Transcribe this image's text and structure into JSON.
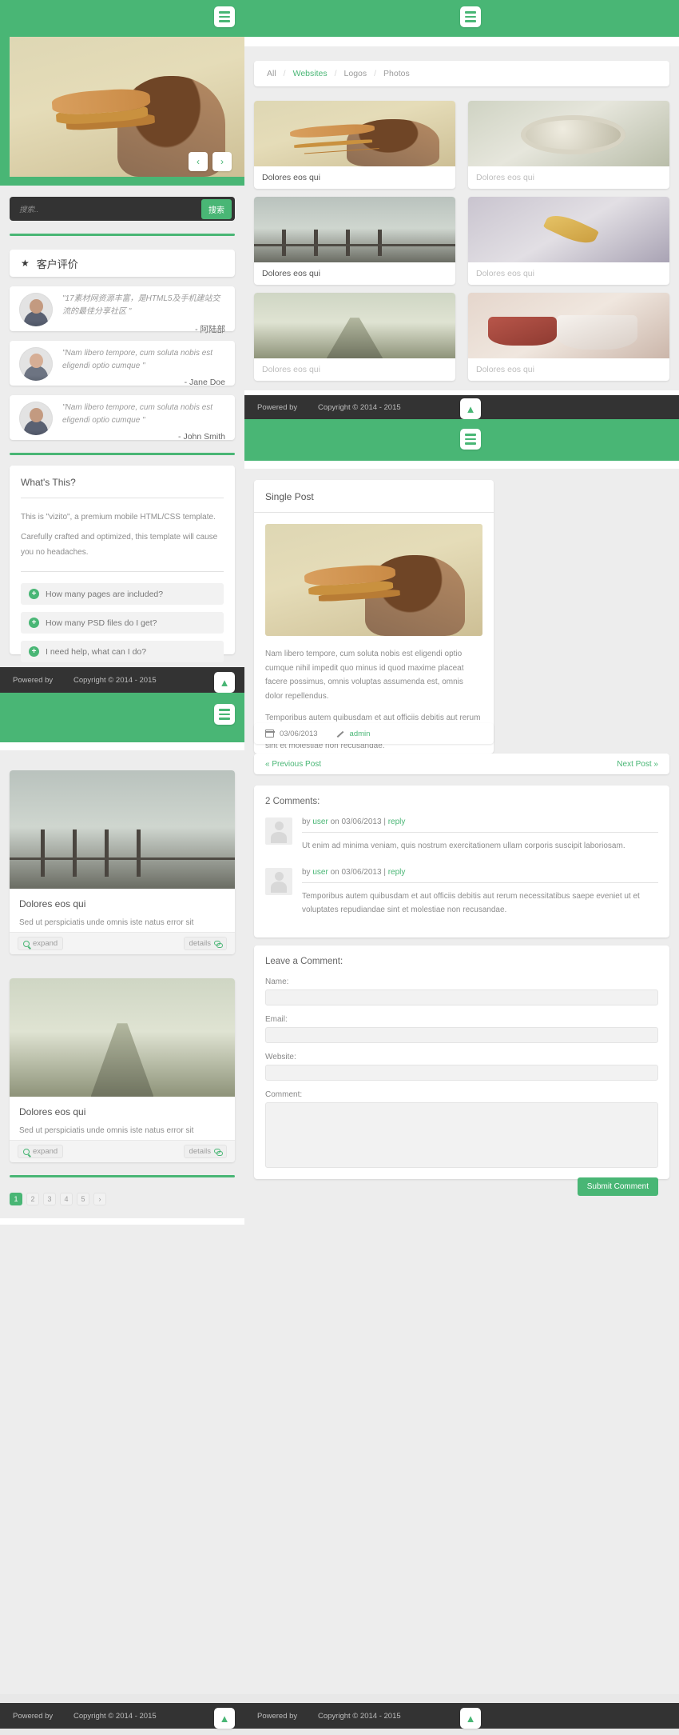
{
  "theme": {
    "green": "#49b675",
    "dark": "#333333",
    "page_bg": "#ededed"
  },
  "screens": {
    "home": {
      "search": {
        "placeholder": "搜索..",
        "button_label": "搜索"
      },
      "testimonials_heading": "客户评价",
      "testimonials": [
        {
          "quote": "\"17素材网资源丰富，是HTML5及手机建站交流的最佳分享社区 \"",
          "author": "- 阿陆部"
        },
        {
          "quote": "\"Nam libero tempore, cum soluta nobis est eligendi optio cumque \"",
          "author": "- Jane Doe"
        },
        {
          "quote": "\"Nam libero tempore, cum soluta nobis est eligendi optio cumque \"",
          "author": "- John Smith"
        }
      ],
      "slider": {
        "prev": "‹",
        "next": "›"
      }
    },
    "about": {
      "title": "What's This?",
      "paragraphs": [
        "This is \"vizito\", a premium mobile HTML/CSS template.",
        "Carefully crafted and optimized, this template will cause you no headaches."
      ],
      "faq": [
        "How many pages are included?",
        "How many PSD files do I get?",
        "I need help, what can I do?"
      ]
    },
    "gallery": {
      "filters": [
        {
          "label": "All",
          "active": false
        },
        {
          "label": "Websites",
          "active": true
        },
        {
          "label": "Logos",
          "active": false
        },
        {
          "label": "Photos",
          "active": false
        }
      ],
      "separator": "/",
      "items": [
        {
          "caption": "Dolores eos qui",
          "dim": false,
          "img": "ph-plane"
        },
        {
          "caption": "Dolores eos qui",
          "dim": true,
          "img": "ph-compass"
        },
        {
          "caption": "Dolores eos qui",
          "dim": false,
          "img": "ph-pier"
        },
        {
          "caption": "Dolores eos qui",
          "dim": true,
          "img": "ph-leaf"
        },
        {
          "caption": "Dolores eos qui",
          "dim": true,
          "img": "ph-rail"
        },
        {
          "caption": "Dolores eos qui",
          "dim": true,
          "img": "ph-mug"
        }
      ]
    },
    "blog_list": {
      "posts": [
        {
          "title": "Dolores eos qui",
          "excerpt": "Sed ut perspiciatis unde omnis iste natus error sit voluptatem accusantium doloremque laudantium.",
          "expand_label": "expand",
          "details_label": "details",
          "img": "ph-pier"
        },
        {
          "title": "Dolores eos qui",
          "excerpt": "Sed ut perspiciatis unde omnis iste natus error sit voluptatem accusantium doloremque laudantium.",
          "expand_label": "expand",
          "details_label": "details",
          "img": "ph-rail"
        }
      ],
      "pagination": {
        "current": "1",
        "pages": [
          "2",
          "3",
          "4",
          "5"
        ],
        "next": "›"
      }
    },
    "single_post": {
      "title": "Single Post",
      "image": "ph-plane",
      "paragraphs": [
        "Nam libero tempore, cum soluta nobis est eligendi optio cumque nihil impedit quo minus id quod maxime placeat facere possimus, omnis voluptas assumenda est, omnis dolor repellendus.",
        "Temporibus autem quibusdam et aut officiis debitis aut rerum necessitatibus saepe eveniet ut et voluptates repudiandae sint et molestiae non recusandae."
      ],
      "meta": {
        "date": "03/06/2013",
        "author": "admin"
      },
      "nav": {
        "prev": "« Previous Post",
        "next": "Next Post »"
      },
      "comments_heading": "2 Comments:",
      "comments": [
        {
          "by": "by",
          "user": "user",
          "on": "on",
          "date": "03/06/2013",
          "sep": "|",
          "reply": "reply",
          "body": "Ut enim ad minima veniam, quis nostrum exercitationem ullam corporis suscipit laboriosam."
        },
        {
          "by": "by",
          "user": "user",
          "on": "on",
          "date": "03/06/2013",
          "sep": "|",
          "reply": "reply",
          "body": "Temporibus autem quibusdam et aut officiis debitis aut rerum necessitatibus saepe eveniet ut et voluptates repudiandae sint et molestiae non recusandae."
        }
      ],
      "form": {
        "heading": "Leave a Comment:",
        "fields": [
          {
            "label": "Name:",
            "value": ""
          },
          {
            "label": "Email:",
            "value": ""
          },
          {
            "label": "Website:",
            "value": ""
          },
          {
            "label": "Comment:",
            "value": ""
          }
        ],
        "submit_label": "Submit Comment"
      }
    }
  },
  "footer": {
    "powered_by": "Powered by",
    "copyright": "Copyright © 2014 - 2015"
  },
  "icons": {
    "burger": "hamburger-menu-icon",
    "scroll_top": "chevron-up-icon",
    "star": "★",
    "plus": "+"
  }
}
